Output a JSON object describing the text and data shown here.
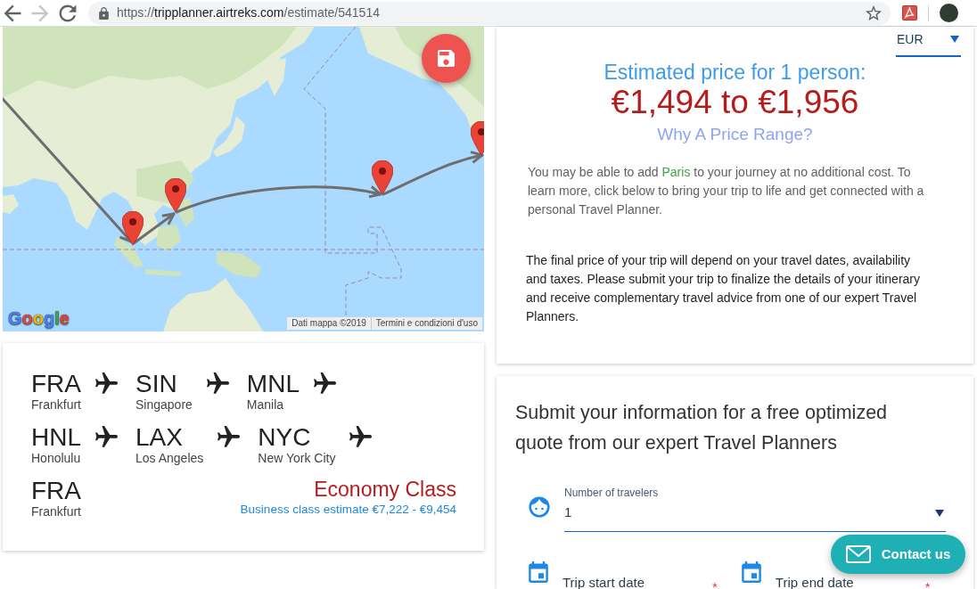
{
  "browser": {
    "nav_buttons": [
      {
        "kind": "back",
        "disabled": false
      },
      {
        "kind": "forward",
        "disabled": true
      },
      {
        "kind": "reload",
        "disabled": false
      }
    ],
    "url": {
      "scheme": "https://",
      "host": "tripplanner.airtreks.com",
      "path": "/estimate/541514"
    }
  },
  "map": {
    "logo": "Google",
    "attribution": [
      "Dati mappa ©2019",
      "Termini e condizioni d'uso"
    ]
  },
  "itinerary": {
    "stops": [
      {
        "code": "FRA",
        "city": "Frankfurt"
      },
      {
        "code": "SIN",
        "city": "Singapore"
      },
      {
        "code": "MNL",
        "city": "Manila"
      },
      {
        "code": "HNL",
        "city": "Honolulu"
      },
      {
        "code": "LAX",
        "city": "Los Angeles"
      },
      {
        "code": "NYC",
        "city": "New York City"
      },
      {
        "code": "FRA",
        "city": "Frankfurt"
      }
    ],
    "cabin_class": "Economy Class",
    "business_estimate": "Business class estimate €7,222 - €9,454"
  },
  "estimate": {
    "currency": "EUR",
    "heading": "Estimated price for 1 person:",
    "price": "€1,494 to €1,956",
    "price_range_link": "Why A Price Range?",
    "note": [
      {
        "text": "You may be able to add ",
        "highlight": false
      },
      {
        "text": "Paris",
        "highlight": true
      },
      {
        "text": " to your journey at no additional cost. To learn more, click below to bring your trip to life and get connected with a personal Travel Planner.",
        "highlight": false
      }
    ],
    "disclaimer": "The final price of your trip will depend on your travel dates, availability and taxes. Please submit your trip to finalize the details of your itinerary and receive complementary travel advice from one of our expert Travel Planners."
  },
  "quote_form": {
    "title": "Submit your information for a free optimized quote from our expert Travel Planners",
    "fields": [
      {
        "kind": "select",
        "label": "Number of travelers",
        "value": "1"
      },
      {
        "kind": "date",
        "placeholder": "Trip start date",
        "required_mark": "*"
      },
      {
        "kind": "date",
        "placeholder": "Trip end date",
        "required_mark": "*"
      }
    ]
  },
  "contact_button": "Contact us"
}
